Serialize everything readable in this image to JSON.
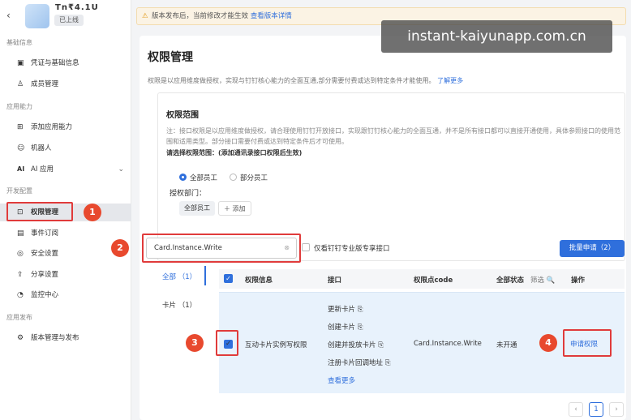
{
  "app": {
    "back_glyph": "‹",
    "name": "Tn₹4.1U",
    "status": "已上线"
  },
  "sidebar": {
    "sections": [
      {
        "label": "基础信息"
      },
      {
        "label": "应用能力"
      },
      {
        "label": "开发配置"
      },
      {
        "label": "应用发布"
      }
    ],
    "items": [
      {
        "icon": "certificate-icon",
        "glyph": "▣",
        "label": "凭证与基础信息"
      },
      {
        "icon": "member-icon",
        "glyph": "♙",
        "label": "成员管理"
      },
      {
        "icon": "add-capability-icon",
        "glyph": "⊞",
        "label": "添加应用能力"
      },
      {
        "icon": "robot-icon",
        "glyph": "☺",
        "label": "机器人"
      },
      {
        "icon": "ai-icon",
        "glyph": "AI",
        "label": "AI 应用",
        "chevron": "⌄"
      },
      {
        "icon": "permission-icon",
        "glyph": "⊡",
        "label": "权限管理"
      },
      {
        "icon": "event-icon",
        "glyph": "▤",
        "label": "事件订阅"
      },
      {
        "icon": "security-icon",
        "glyph": "◎",
        "label": "安全设置"
      },
      {
        "icon": "share-icon",
        "glyph": "⇪",
        "label": "分享设置"
      },
      {
        "icon": "monitor-icon",
        "glyph": "◔",
        "label": "监控中心"
      },
      {
        "icon": "version-icon",
        "glyph": "⚙",
        "label": "版本管理与发布"
      }
    ]
  },
  "banner": {
    "icon": "⚠",
    "text": "版本发布后，当前修改才能生效",
    "link": "查看版本详情"
  },
  "watermark": "instant-kaiyunapp.com.cn",
  "page": {
    "title": "权限管理",
    "desc": "权限是以应用维度做授权，实现与钉钉核心能力的全面互通,部分需要付费或达到特定条件才能使用。",
    "desc_link": "了解更多"
  },
  "scope": {
    "title": "权限范围",
    "note": "注：接口权限是以应用维度做授权，请合理使用钉钉开放接口，实现跟钉钉核心能力的全面互通，并不是所有接口都可以直接开通使用，具体参照接口的使用范围和适用类型。部分接口需要付费或达到特定条件后才可使用。",
    "select_label": "请选择权限范围：(添加通讯录接口权限后生效)",
    "radio_all": "全部员工",
    "radio_part": "部分员工",
    "dept_label": "授权部门：",
    "dept_tag": "全部员工",
    "add_label": "＋ 添加"
  },
  "filter": {
    "search_value": "Card.Instance.Write",
    "clear_glyph": "⊗",
    "only_pro": "仅看钉钉专业版专享接口",
    "batch": "批量申请（2）"
  },
  "categories": [
    {
      "label": "全部 （1）"
    },
    {
      "label": "卡片 （1）"
    }
  ],
  "table": {
    "headers": {
      "check": "✓",
      "info": "权限信息",
      "iface": "接口",
      "code": "权限点code",
      "status": "全部状态",
      "filter": "筛选 🔍",
      "op": "操作"
    },
    "row": {
      "name": "互动卡片实例写权限",
      "interfaces": [
        "更新卡片 ⎘",
        "创建卡片 ⎘",
        "创建并投放卡片 ⎘",
        "注册卡片回调地址 ⎘"
      ],
      "more": "查看更多",
      "code": "Card.Instance.Write",
      "status": "未开通",
      "action": "申请权限"
    }
  },
  "pager": {
    "prev": "‹",
    "page": "1",
    "next": "›"
  },
  "steps": [
    "1",
    "2",
    "3",
    "4"
  ]
}
